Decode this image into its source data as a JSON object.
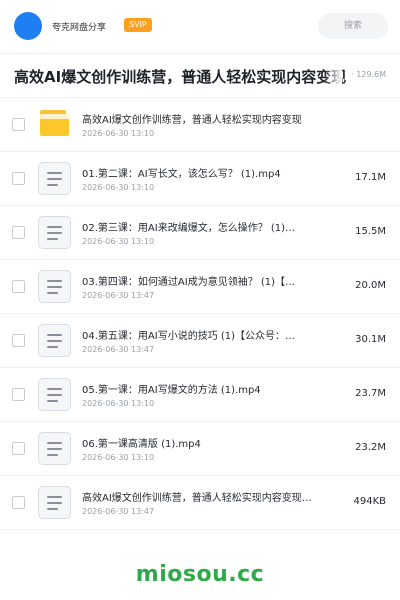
{
  "header": {
    "owner_name": "夸克网盘分享",
    "badge": "SVIP",
    "search_placeholder": "搜索"
  },
  "share": {
    "title": "高效AI爆文创作训练营，普通人轻松实现内容变现",
    "total_label": "· 129.6M"
  },
  "files": [
    {
      "icon": "folder-icon",
      "name": "高效AI爆文创作训练营，普通人轻松实现内容变现",
      "date": "2026-06-30 13:10",
      "size": ""
    },
    {
      "icon": "video-file-icon",
      "name": "01.第二课：AI写长文，该怎么写？ (1).mp4",
      "date": "2026-06-30 13:10",
      "size": "17.1M"
    },
    {
      "icon": "video-file-icon",
      "name": "02.第三课：用AI来改编爆文，怎么操作？ (1)…",
      "date": "2026-06-30 13:10",
      "size": "15.5M"
    },
    {
      "icon": "video-file-icon",
      "name": "03.第四课：如何通过AI成为意见领袖？ (1)【…",
      "date": "2026-06-30 13:47",
      "size": "20.0M"
    },
    {
      "icon": "video-file-icon",
      "name": "04.第五课：用AI写小说的技巧 (1)【公众号：…",
      "date": "2026-06-30 13:47",
      "size": "30.1M"
    },
    {
      "icon": "video-file-icon",
      "name": "05.第一课：用AI写爆文的方法 (1).mp4",
      "date": "2026-06-30 13:10",
      "size": "23.7M"
    },
    {
      "icon": "video-file-icon",
      "name": "06.第一课高清版 (1).mp4",
      "date": "2026-06-30 13:10",
      "size": "23.2M"
    },
    {
      "icon": "document-file-icon",
      "name": "高效AI爆文创作训练营，普通人轻松实现内容变现必看…",
      "date": "2026-06-30 13:47",
      "size": "494KB"
    }
  ],
  "watermark": "miosou.cc"
}
